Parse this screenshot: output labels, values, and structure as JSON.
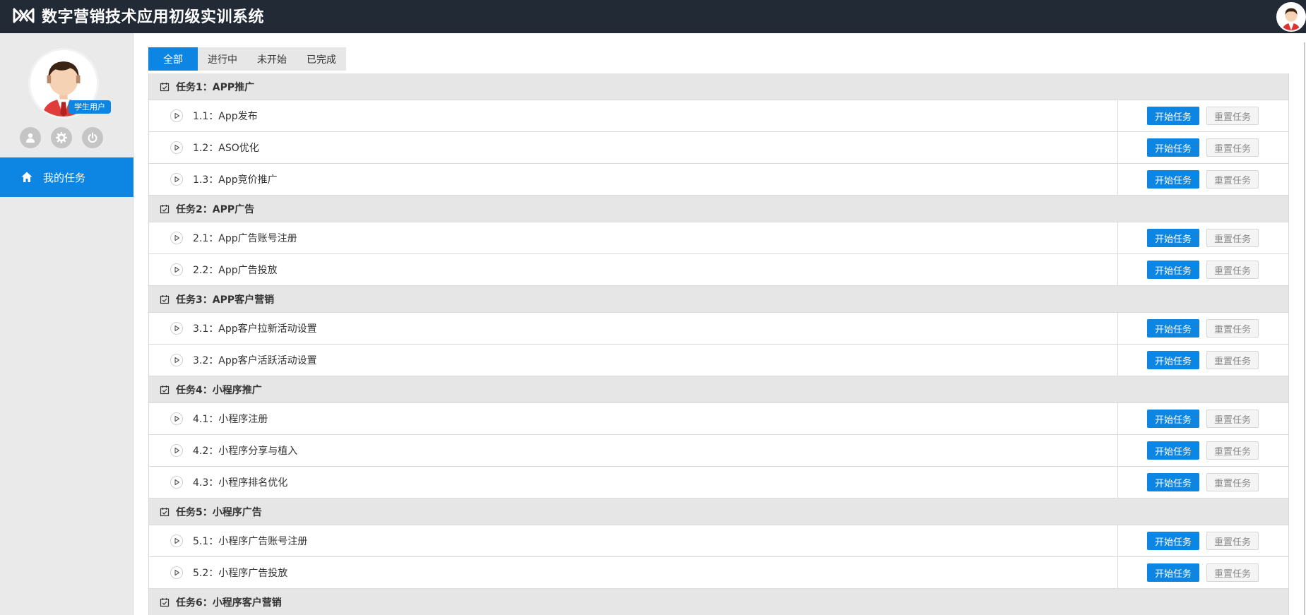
{
  "app": {
    "title": "数字营销技术应用初级实训系统"
  },
  "user": {
    "role_badge": "学生用户"
  },
  "sidebar": {
    "nav_label": "我的任务"
  },
  "colors": {
    "topbar": "#222a36",
    "accent": "#0c85e3",
    "sidebar": "#eaeaea"
  },
  "tabs": [
    {
      "label": "全部",
      "active": true
    },
    {
      "label": "进行中",
      "active": false
    },
    {
      "label": "未开始",
      "active": false
    },
    {
      "label": "已完成",
      "active": false
    }
  ],
  "buttons": {
    "start": "开始任务",
    "reset": "重置任务"
  },
  "groups": [
    {
      "title": "任务1：APP推广",
      "tasks": [
        "1.1：App发布",
        "1.2：ASO优化",
        "1.3：App竞价推广"
      ]
    },
    {
      "title": "任务2：APP广告",
      "tasks": [
        "2.1：App广告账号注册",
        "2.2：App广告投放"
      ]
    },
    {
      "title": "任务3：APP客户营销",
      "tasks": [
        "3.1：App客户拉新活动设置",
        "3.2：App客户活跃活动设置"
      ]
    },
    {
      "title": "任务4：小程序推广",
      "tasks": [
        "4.1：小程序注册",
        "4.2：小程序分享与植入",
        "4.3：小程序排名优化"
      ]
    },
    {
      "title": "任务5：小程序广告",
      "tasks": [
        "5.1：小程序广告账号注册",
        "5.2：小程序广告投放"
      ]
    },
    {
      "title": "任务6：小程序客户营销",
      "tasks": []
    }
  ]
}
